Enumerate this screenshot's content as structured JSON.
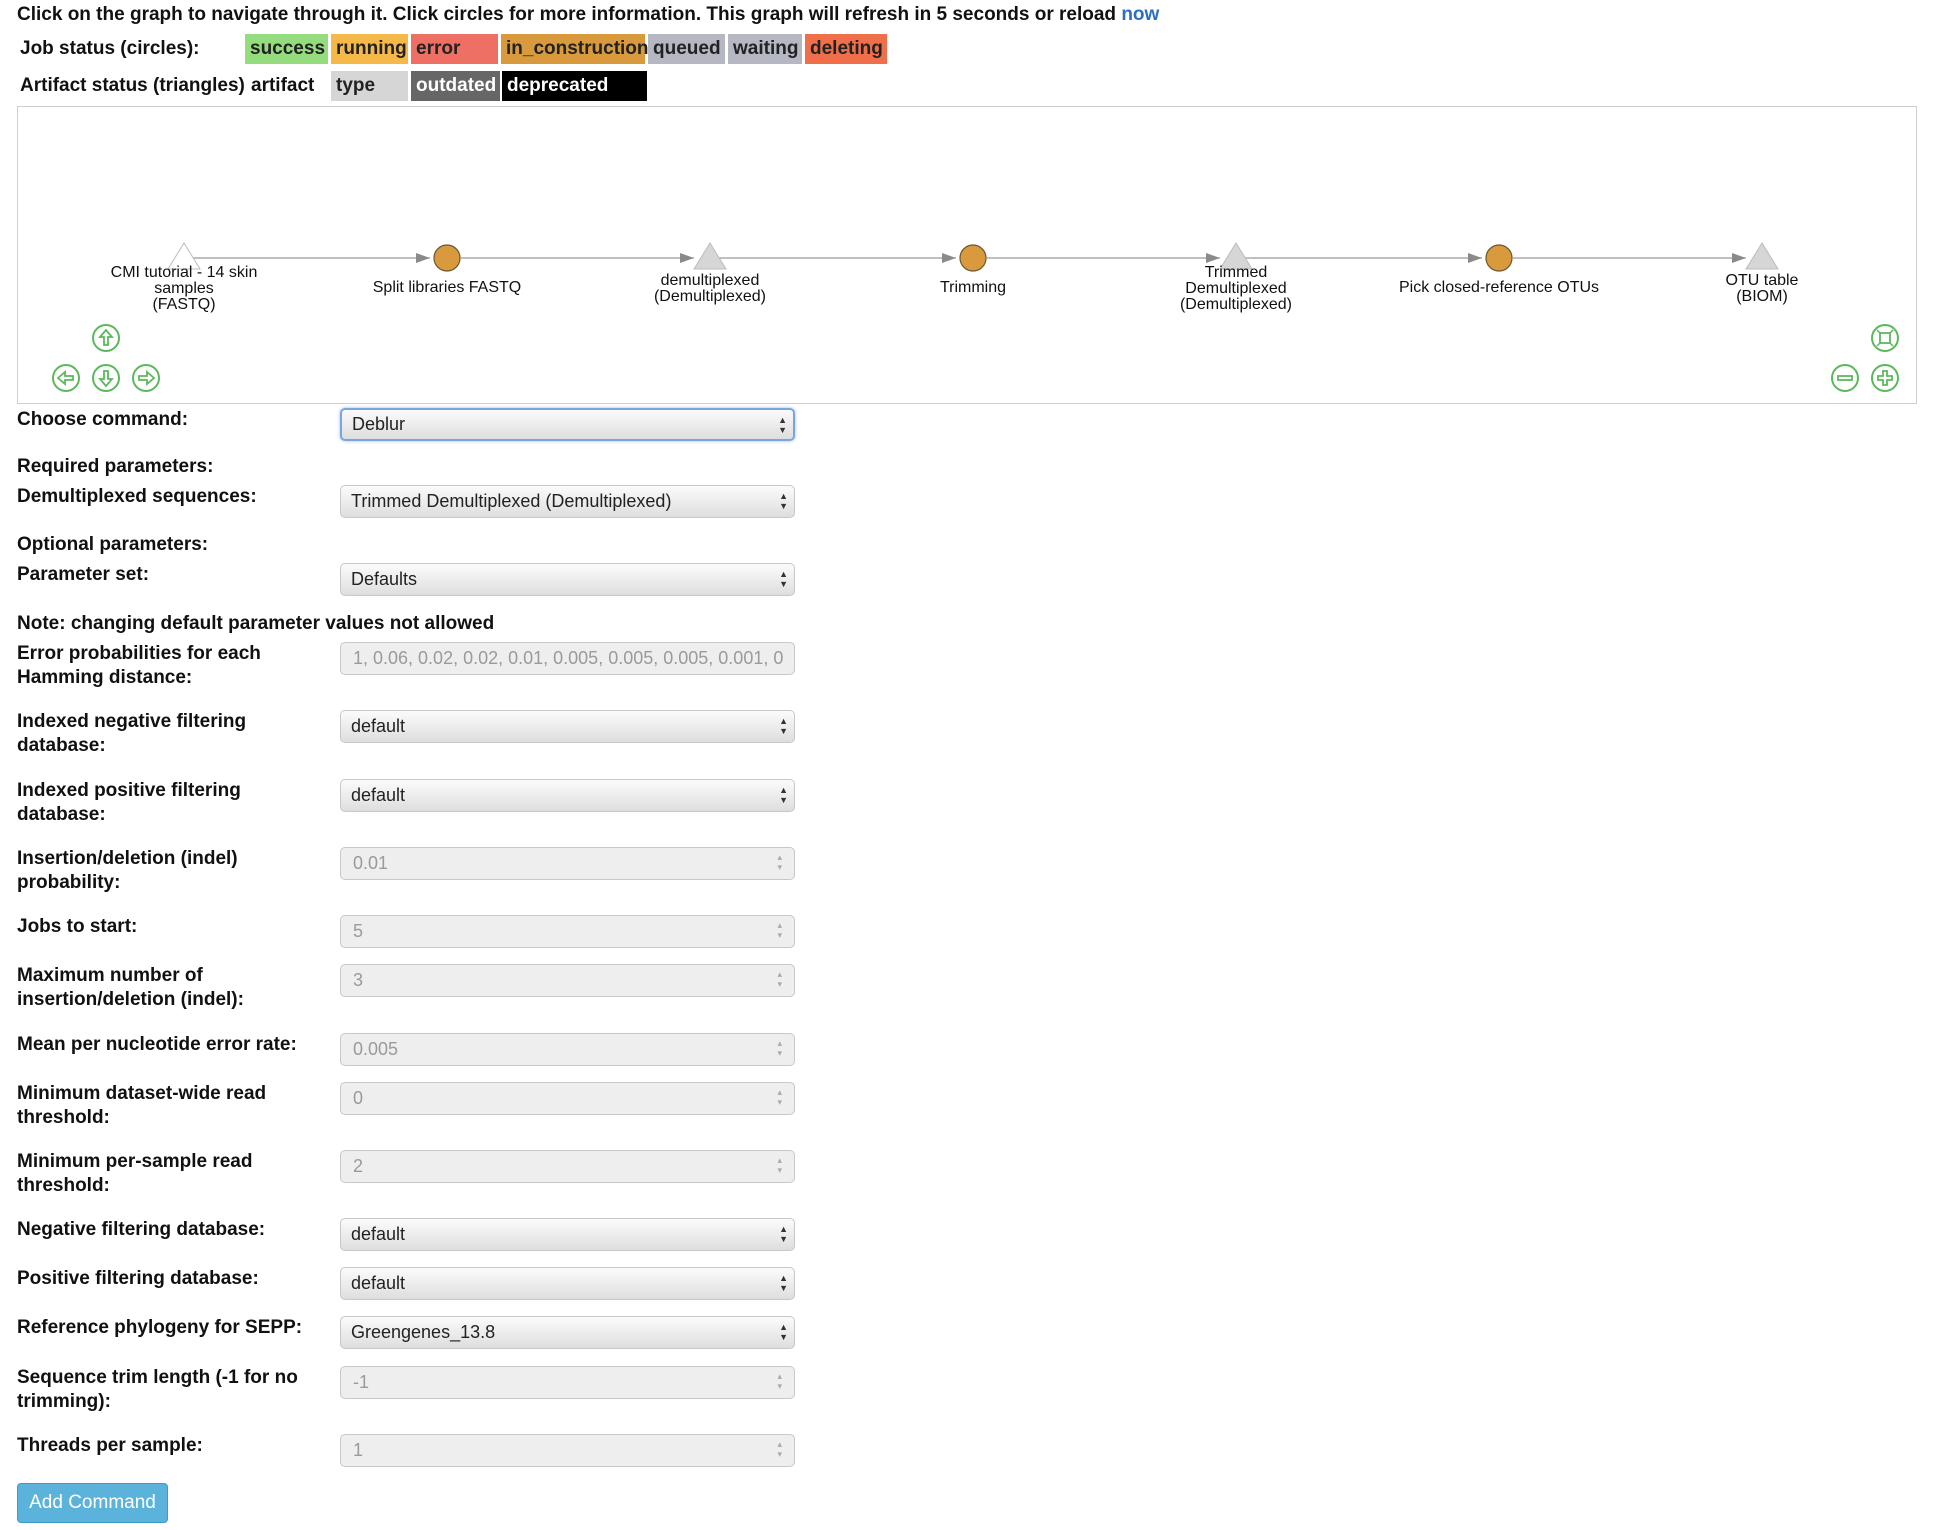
{
  "notice": {
    "text": "Click on the graph to navigate through it. Click circles for more information. This graph will refresh in 5 seconds or reload ",
    "link": "now"
  },
  "legend": {
    "job_label": "Job status (circles):",
    "jobs": [
      {
        "label": "success",
        "color": "#95dc7e"
      },
      {
        "label": "running",
        "color": "#f5b94a"
      },
      {
        "label": "error",
        "color": "#ee6f63"
      },
      {
        "label": "in_construction",
        "color": "#d89a3d"
      },
      {
        "label": "queued",
        "color": "#b5b8c2"
      },
      {
        "label": "waiting",
        "color": "#b5b8c2"
      },
      {
        "label": "deleting",
        "color": "#ee6f4a"
      }
    ],
    "artifact_label": "Artifact status (triangles):",
    "artifacts": [
      {
        "label": "artifact",
        "color": "#ffffff",
        "text": "#111111"
      },
      {
        "label": "type",
        "color": "#d6d6d6",
        "text": "#222222"
      },
      {
        "label": "outdated",
        "color": "#666666",
        "text": "#ffffff"
      },
      {
        "label": "deprecated",
        "color": "#000000",
        "text": "#ffffff"
      }
    ]
  },
  "graph": {
    "nodes": [
      {
        "kind": "triangle",
        "lines": [
          "CMI tutorial - 14 skin",
          "samples",
          "(FASTQ)"
        ],
        "fill": "#ffffff"
      },
      {
        "kind": "circle",
        "lines": [
          "Split libraries FASTQ"
        ],
        "fill": "#d89a3d"
      },
      {
        "kind": "triangle",
        "lines": [
          "demultiplexed",
          "(Demultiplexed)"
        ],
        "fill": "#d6d6d6"
      },
      {
        "kind": "circle",
        "lines": [
          "Trimming"
        ],
        "fill": "#d89a3d"
      },
      {
        "kind": "triangle",
        "lines": [
          "Trimmed",
          "Demultiplexed",
          "(Demultiplexed)"
        ],
        "fill": "#d6d6d6"
      },
      {
        "kind": "circle",
        "lines": [
          "Pick closed-reference OTUs"
        ],
        "fill": "#d89a3d"
      },
      {
        "kind": "triangle",
        "lines": [
          "OTU table",
          "(BIOM)"
        ],
        "fill": "#d6d6d6"
      }
    ]
  },
  "form": {
    "choose_command_label": "Choose command:",
    "choose_command_value": "Deblur",
    "required_label": "Required parameters:",
    "demux_label": "Demultiplexed sequences:",
    "demux_value": "Trimmed Demultiplexed (Demultiplexed)",
    "optional_label": "Optional parameters:",
    "paramset_label": "Parameter set:",
    "paramset_value": "Defaults",
    "note": "Note: changing default parameter values not allowed",
    "params": [
      {
        "label": "Error probabilities for each Hamming distance:",
        "value": "1, 0.06, 0.02, 0.02, 0.01, 0.005, 0.005, 0.005, 0.001, 0",
        "kind": "text"
      },
      {
        "label": "Indexed negative filtering database:",
        "value": "default",
        "kind": "select"
      },
      {
        "label": "Indexed positive filtering database:",
        "value": "default",
        "kind": "select"
      },
      {
        "label": "Insertion/deletion (indel) probability:",
        "value": "0.01",
        "kind": "number"
      },
      {
        "label": "Jobs to start:",
        "value": "5",
        "kind": "number"
      },
      {
        "label": "Maximum number of insertion/deletion (indel):",
        "value": "3",
        "kind": "number"
      },
      {
        "label": "Mean per nucleotide error rate:",
        "value": "0.005",
        "kind": "number"
      },
      {
        "label": "Minimum dataset-wide read threshold:",
        "value": "0",
        "kind": "number"
      },
      {
        "label": "Minimum per-sample read threshold:",
        "value": "2",
        "kind": "number"
      },
      {
        "label": "Negative filtering database:",
        "value": "default",
        "kind": "select"
      },
      {
        "label": "Positive filtering database:",
        "value": "default",
        "kind": "select"
      },
      {
        "label": "Reference phylogeny for SEPP:",
        "value": "Greengenes_13.8",
        "kind": "select"
      },
      {
        "label": "Sequence trim length (-1 for no trimming):",
        "value": "-1",
        "kind": "number"
      },
      {
        "label": "Threads per sample:",
        "value": "1",
        "kind": "number"
      }
    ],
    "submit_label": "Add Command"
  }
}
